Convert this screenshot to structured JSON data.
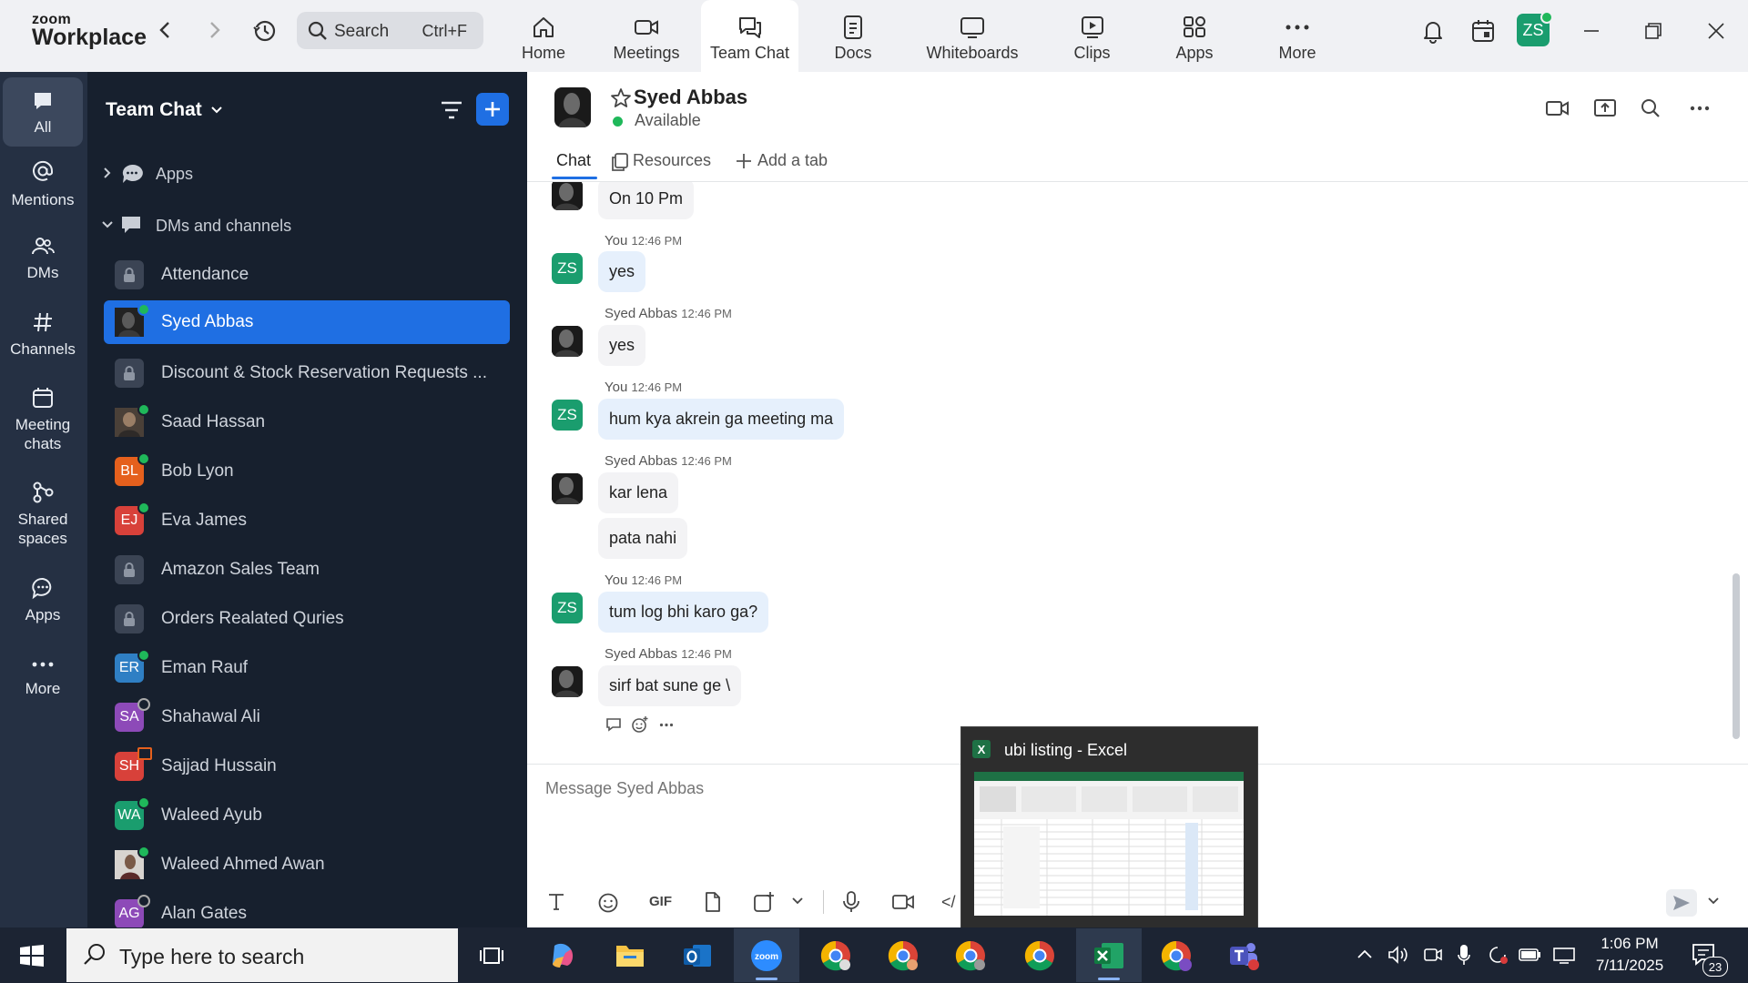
{
  "app": {
    "logo_top": "zoom",
    "logo_bottom": "Workplace"
  },
  "search": {
    "label": "Search",
    "shortcut": "Ctrl+F"
  },
  "tabs": [
    {
      "label": "Home",
      "icon": "home-icon"
    },
    {
      "label": "Meetings",
      "icon": "video-icon"
    },
    {
      "label": "Team Chat",
      "icon": "chat-icon",
      "active": true
    },
    {
      "label": "Docs",
      "icon": "doc-icon"
    },
    {
      "label": "Whiteboards",
      "icon": "whiteboard-icon"
    },
    {
      "label": "Clips",
      "icon": "clip-icon"
    },
    {
      "label": "Apps",
      "icon": "apps-icon"
    },
    {
      "label": "More",
      "icon": "more-icon"
    }
  ],
  "user": {
    "initials": "ZS"
  },
  "rail": [
    {
      "label": "All"
    },
    {
      "label": "Mentions"
    },
    {
      "label": "DMs"
    },
    {
      "label": "Channels"
    },
    {
      "label": "Meeting chats"
    },
    {
      "label": "Shared spaces"
    },
    {
      "label": "Apps"
    },
    {
      "label": "More"
    }
  ],
  "chatlist": {
    "title": "Team Chat",
    "apps_label": "Apps",
    "dms_label": "DMs and channels",
    "items": [
      {
        "name": "Attendance",
        "initials": "",
        "type": "channel"
      },
      {
        "name": "Syed Abbas",
        "initials": "",
        "type": "photo",
        "active": true
      },
      {
        "name": "Discount & Stock Reservation Requests ...",
        "initials": "",
        "type": "channel"
      },
      {
        "name": "Saad Hassan",
        "initials": "",
        "type": "photo"
      },
      {
        "name": "Bob Lyon",
        "initials": "BL",
        "type": "initials",
        "color": "#e5601d"
      },
      {
        "name": "Eva James",
        "initials": "EJ",
        "type": "initials",
        "color": "#d8413a"
      },
      {
        "name": "Amazon Sales Team",
        "initials": "",
        "type": "channel"
      },
      {
        "name": "Orders Realated Quries",
        "initials": "",
        "type": "channel"
      },
      {
        "name": "Eman Rauf",
        "initials": "ER",
        "type": "initials",
        "color": "#2f7fc4"
      },
      {
        "name": "Shahawal Ali",
        "initials": "SA",
        "type": "initials",
        "color": "#8d4ab8"
      },
      {
        "name": "Sajjad Hussain",
        "initials": "SH",
        "type": "initials",
        "color": "#d8413a"
      },
      {
        "name": "Waleed Ayub",
        "initials": "WA",
        "type": "initials",
        "color": "#1a9d6e"
      },
      {
        "name": "Waleed Ahmed Awan",
        "initials": "",
        "type": "photo"
      },
      {
        "name": "Alan Gates",
        "initials": "AG",
        "type": "initials",
        "color": "#8d4ab8"
      }
    ]
  },
  "conversation": {
    "name": "Syed Abbas",
    "status": "Available",
    "tabs": {
      "chat": "Chat",
      "resources": "Resources",
      "add": "Add a tab"
    },
    "messages": [
      {
        "sender": "",
        "time": "",
        "lines": [
          "On 10 Pm"
        ],
        "me": false
      },
      {
        "sender": "You",
        "time": "12:46 PM",
        "lines": [
          "yes"
        ],
        "me": true
      },
      {
        "sender": "Syed Abbas",
        "time": "12:46 PM",
        "lines": [
          "yes"
        ],
        "me": false
      },
      {
        "sender": "You",
        "time": "12:46 PM",
        "lines": [
          "hum kya akrein ga meeting ma"
        ],
        "me": true
      },
      {
        "sender": "Syed Abbas",
        "time": "12:46 PM",
        "lines": [
          "kar lena",
          "pata  nahi"
        ],
        "me": false
      },
      {
        "sender": "You",
        "time": "12:46 PM",
        "lines": [
          "tum log bhi karo ga?"
        ],
        "me": true
      },
      {
        "sender": "Syed Abbas",
        "time": "12:46 PM",
        "lines": [
          "sirf bat sune ge \\"
        ],
        "me": false
      }
    ],
    "compose_placeholder": "Message Syed Abbas",
    "toolbar_gif": "GIF"
  },
  "preview": {
    "title": "ubi listing - Excel"
  },
  "taskbar": {
    "search_placeholder": "Type here to search",
    "time": "1:06 PM",
    "date": "7/11/2025",
    "notif_count": "23"
  }
}
